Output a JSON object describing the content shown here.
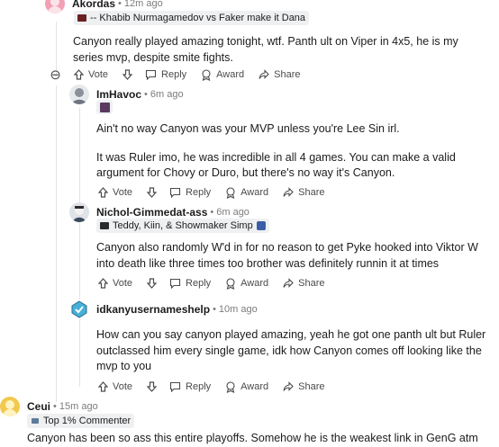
{
  "comments": [
    {
      "username": "Akordas",
      "timestamp": "12m ago",
      "flair": "-- Khabib Nurmagamedov vs Faker make it Dana",
      "body": [
        "Canyon really played amazing tonight, wtf. Panth ult on Viper in 4x5, he is my series mvp, despite smite fights."
      ]
    },
    {
      "username": "ImHavoc",
      "timestamp": "6m ago",
      "flair": "",
      "body": [
        "Ain't no way Canyon was your MVP unless you're Lee Sin irl.",
        "It was Ruler imo, he was incredible in all 4 games. You can make a valid argument for Chovy or Duro, but there's no way it's Canyon."
      ]
    },
    {
      "username": "Nichol-Gimmedat-ass",
      "timestamp": "6m ago",
      "flair": "Teddy, Kiin, & Showmaker Simp",
      "body": [
        "Canyon also randomly W'd in for no reason to get Pyke hooked into Viktor W into death like three times too brother was definitely runnin it at times"
      ]
    },
    {
      "username": "idkanyusernameshelp",
      "timestamp": "10m ago",
      "flair": "",
      "body": [
        "How can you say canyon played amazing, yeah he got one panth ult but Ruler outclassed him every single game, idk how Canyon comes off looking like the mvp to you"
      ]
    },
    {
      "username": "Ceui",
      "timestamp": "15m ago",
      "flair": "Top 1% Commenter",
      "body": [
        "Canyon has been so ass this entire playoffs. Somehow he is the weakest link in GenG atm"
      ]
    }
  ],
  "actions": {
    "collapse": "⊖",
    "vote": "Vote",
    "reply": "Reply",
    "award": "Award",
    "share": "Share"
  },
  "dot": "•"
}
